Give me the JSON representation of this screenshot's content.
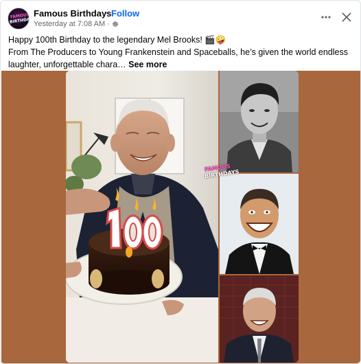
{
  "post": {
    "page_name": "Famous Birthdays",
    "separator": "·",
    "follow_label": "Follow",
    "timestamp": "Yesterday at 7:08 AM",
    "timestamp_sep": "·",
    "audience_icon": "gear-icon",
    "text_line1": "Happy 100th Birthday to the legendary Mel Brooks! 🎬🤪",
    "text_line2": "From The Producers to Young Frankenstein and Spaceballs, he’s given the world endless",
    "text_line3": "laughter, unforgettable chara… ",
    "see_more_label": "See more"
  },
  "avatar": {
    "logo_line1": "FAMOUS",
    "logo_line2": "BIRTHDAYS"
  },
  "photos": {
    "watermark_line1": "FAMOUS",
    "watermark_line2": "BIRTHDAYS",
    "candle_digits": "100"
  },
  "colors": {
    "link_blue": "#0866ff",
    "secondary_text": "#65676b",
    "brand_pink": "#ff5ab9",
    "media_background": "#a8673d"
  },
  "icons": {
    "more": "more-horizontal-icon",
    "close": "close-icon"
  }
}
